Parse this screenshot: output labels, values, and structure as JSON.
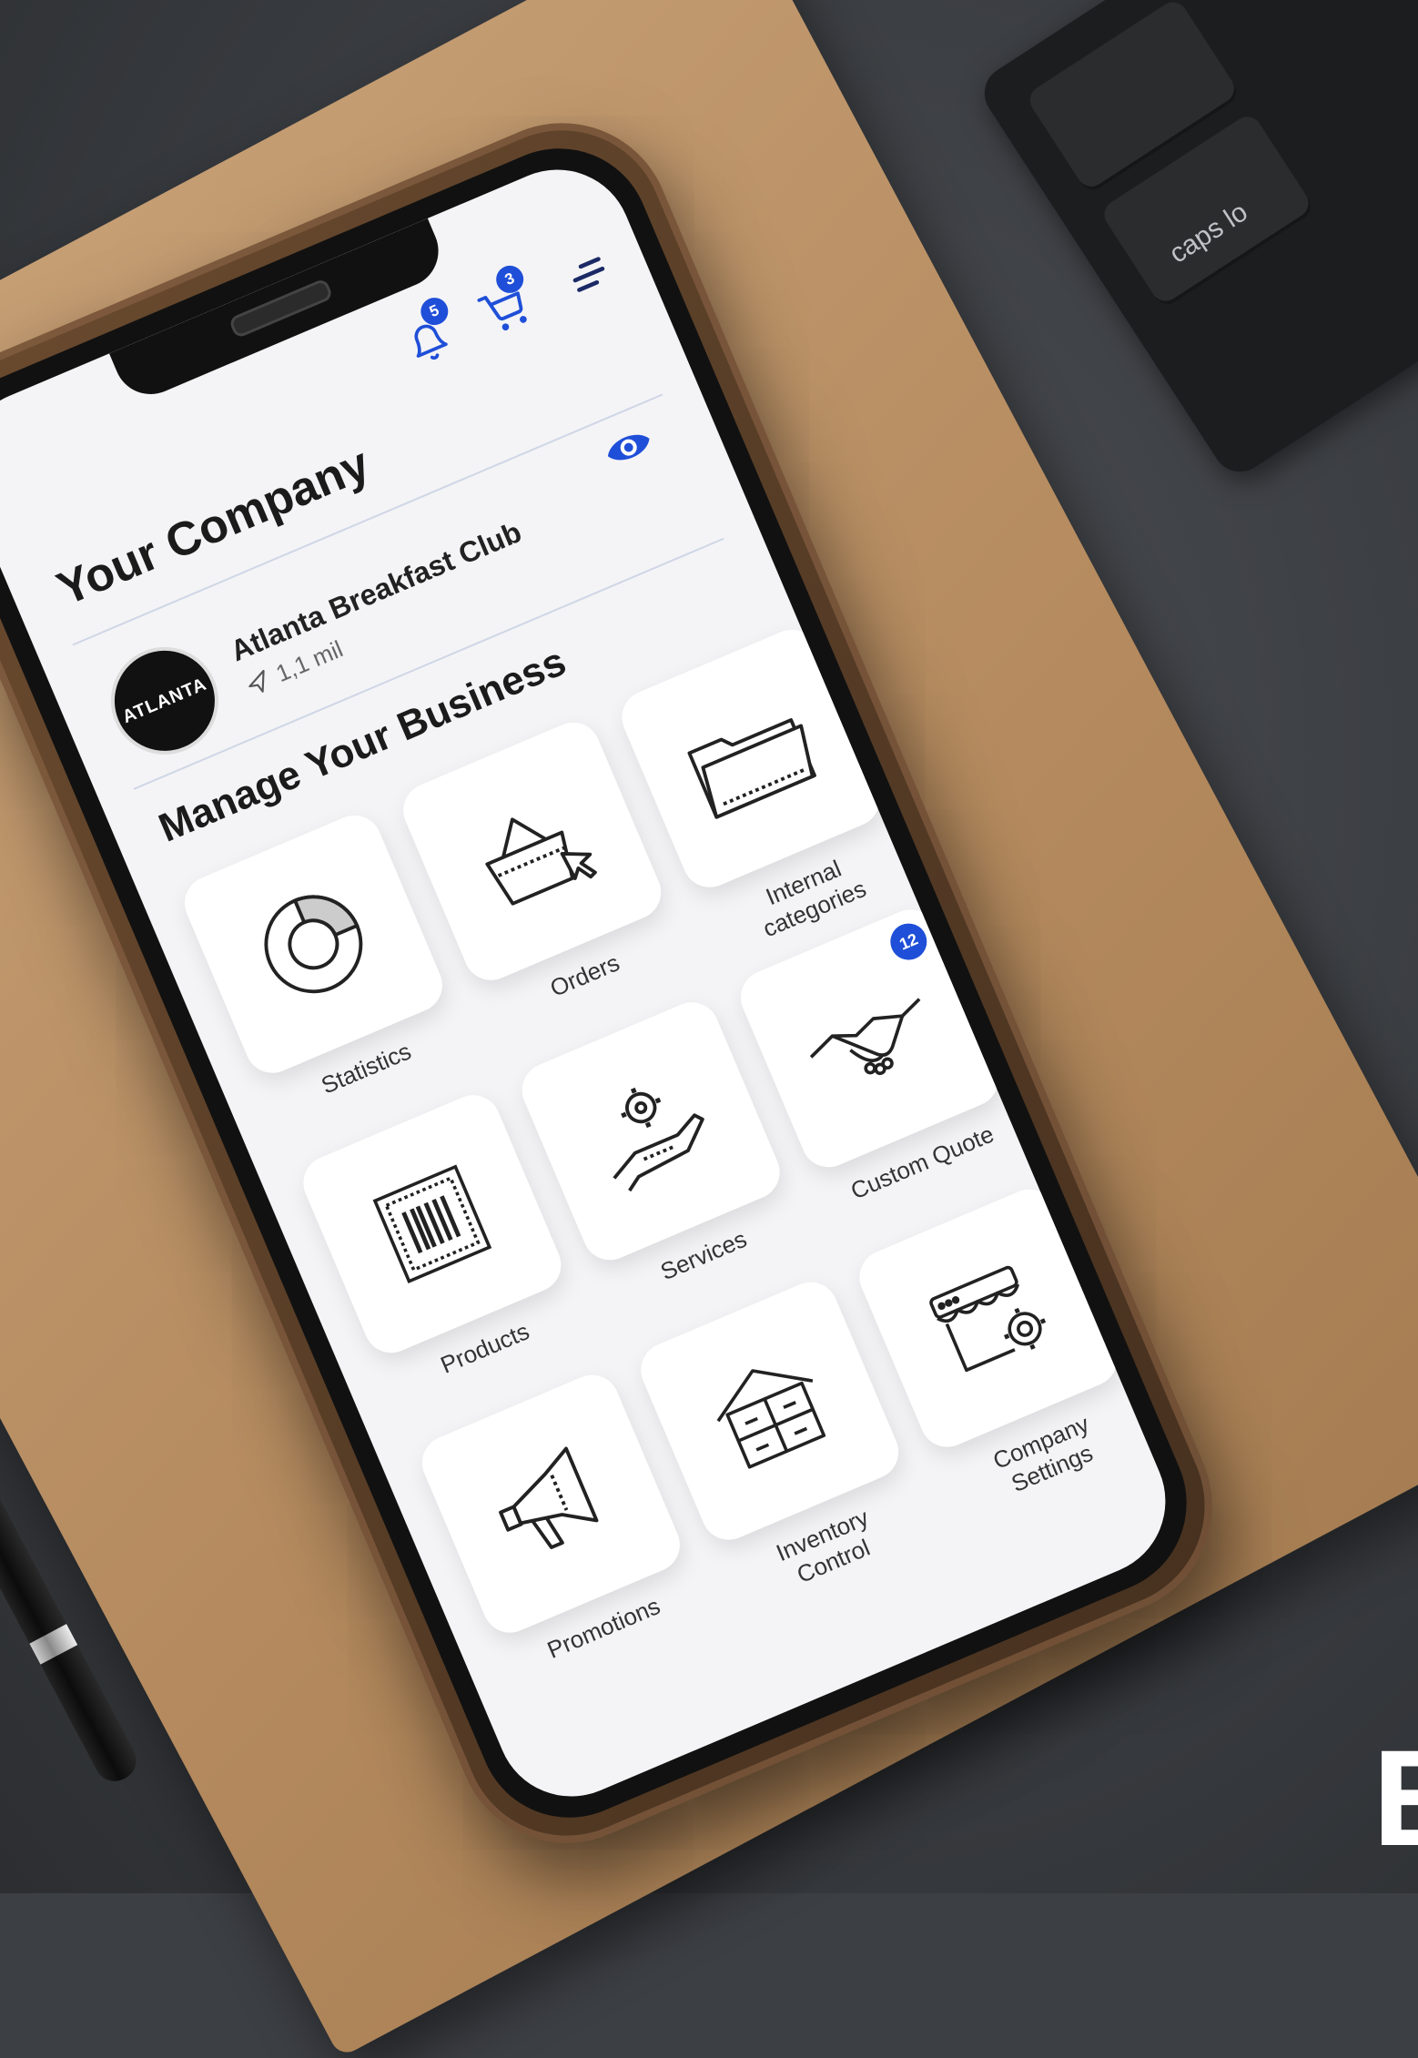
{
  "accent_color": "#1f4fd8",
  "background": {
    "keyboard_key_label": "caps lo",
    "corner_glyph": "E"
  },
  "topbar": {
    "notifications_count": "5",
    "cart_count": "3",
    "icons": [
      "bell-icon",
      "cart-icon",
      "menu-icon"
    ]
  },
  "header": {
    "title": "Your Company"
  },
  "company": {
    "logo_text": "ATLANTA",
    "name": "Atlanta Breakfast Club",
    "distance": "1,1 mil"
  },
  "section_title": "Manage Your Business",
  "tiles": [
    {
      "label": "Statistics",
      "icon": "donut-chart-icon"
    },
    {
      "label": "Orders",
      "icon": "basket-cursor-icon"
    },
    {
      "label": "Internal\ncategories",
      "icon": "folder-icon"
    },
    {
      "label": "Products",
      "icon": "barcode-icon"
    },
    {
      "label": "Services",
      "icon": "hand-gear-icon"
    },
    {
      "label": "Custom Quote",
      "icon": "handshake-icon",
      "badge": "12"
    },
    {
      "label": "Promotions",
      "icon": "megaphone-icon"
    },
    {
      "label": "Inventory\nControl",
      "icon": "warehouse-icon"
    },
    {
      "label": "Company\nSettings",
      "icon": "store-gear-icon"
    }
  ]
}
